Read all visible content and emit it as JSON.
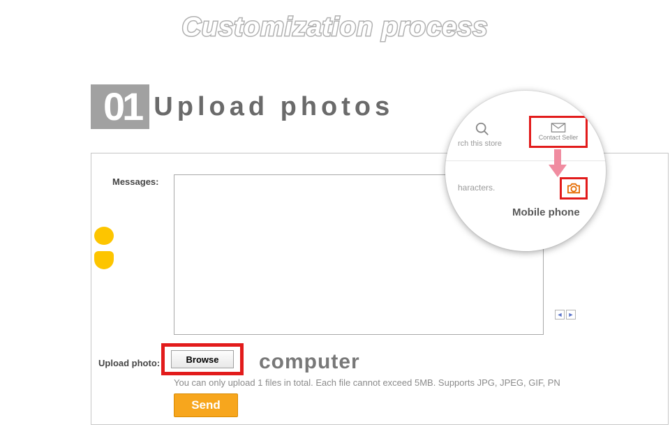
{
  "title": "Customization process",
  "step": {
    "number": "01",
    "title": "Upload photos"
  },
  "form": {
    "messages_label": "Messages:",
    "upload_label": "Upload photo:",
    "browse_label": "Browse",
    "hint": "You can only upload 1 files in total. Each file cannot exceed 5MB. Supports JPG, JPEG, GIF, PN",
    "send_label": "Send",
    "pager_prev": "◄",
    "pager_next": "►"
  },
  "callouts": {
    "computer": "computer",
    "mobile": "Mobile phone"
  },
  "bubble": {
    "search_text": "rch this store",
    "contact_text": "Contact Seller",
    "characters_text": "haracters."
  }
}
